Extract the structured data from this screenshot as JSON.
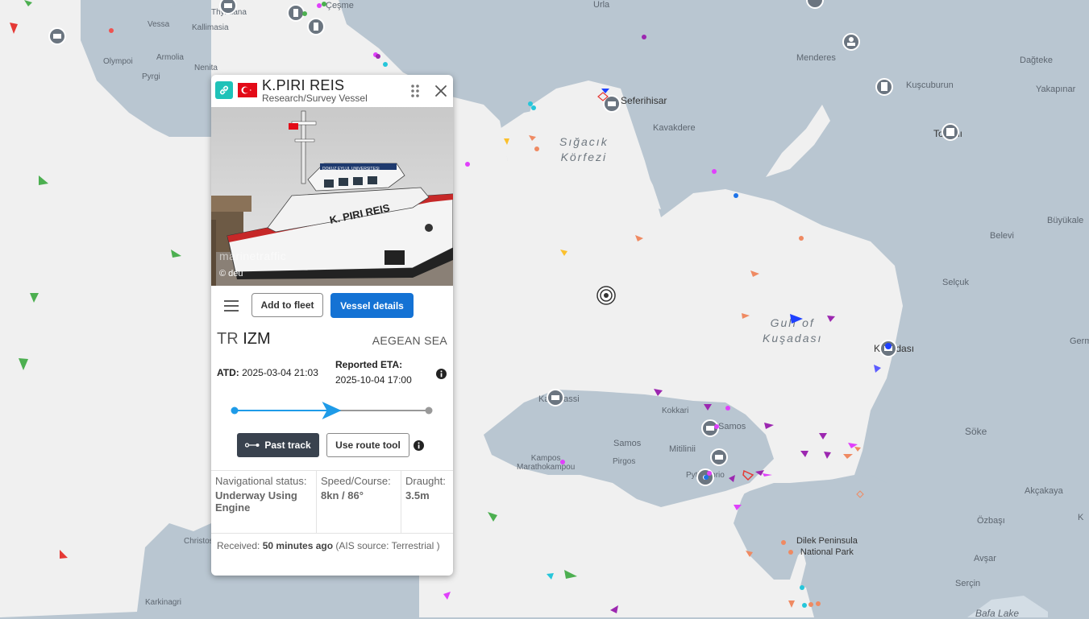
{
  "map": {
    "labels": {
      "urla": "Urla",
      "menderes": "Menderes",
      "dagteke": "Dağteke",
      "kuscuburun": "Kuşcuburun",
      "yakapinar": "Yakapınar",
      "seferihisar": "Seferihisar",
      "kavakdere": "Kavakdere",
      "torbali": "Torbalı",
      "vessa": "Vessa",
      "kallimasia": "Kallimasia",
      "thymiana": "Thymiana",
      "olympoi": "Olympoi",
      "armolia": "Armolia",
      "nenita": "Nenita",
      "pyrgi": "Pyrgi",
      "cesme": "Çeşme",
      "sigacik_line1": "Sığacık",
      "sigacik_line2": "Körfezi",
      "gulf_line1": "Gulf of",
      "gulf_line2": "Kuşadası",
      "kusadasi": "Kuşadası",
      "buyukale": "Büyükale",
      "belevi": "Belevi",
      "selcuk": "Selçuk",
      "germencik": "Germ",
      "karlovassi": "Karlovassi",
      "kokkari": "Kokkari",
      "samos_town": "Samos",
      "samos": "Samos",
      "pirgos": "Pirgos",
      "mitilinii": "Mitilinii",
      "pythagorio": "Pythagorio",
      "kampos_line1": "Kampos",
      "kampos_line2": "Marathokampou",
      "soke": "Söke",
      "akcakaya": "Akçakaya",
      "ozbasi": "Özbaşı",
      "k_edge": "K",
      "avsar": "Avşar",
      "sercin": "Serçin",
      "bafa": "Bafa Lake",
      "christos": "Christos",
      "karkinagri": "Karkinagri",
      "dilek_line1": "Dilek Peninsula",
      "dilek_line2": "National Park"
    }
  },
  "popup": {
    "vessel_name": "K.PIRI REIS",
    "vessel_type": "Research/Survey Vessel",
    "flag_country": "Turkey",
    "photo_watermark": "marinetraffic",
    "photo_credit": "© deu",
    "ship_name_on_hull": "K. PIRI REIS",
    "ship_name_on_bridge": "DOKUZ EYLUL UNIVERSITESI",
    "add_to_fleet_label": "Add to fleet",
    "vessel_details_label": "Vessel details",
    "departure_country": "TR",
    "departure_port": "IZM",
    "area": "AEGEAN SEA",
    "atd_label": "ATD:",
    "atd_value": "2025-03-04 21:03",
    "eta_label": "Reported ETA:",
    "eta_value": "2025-10-04 17:00",
    "voyage_progress_fraction": 0.5,
    "past_track_label": "Past track",
    "route_tool_label": "Use route tool",
    "nav_status_label": "Navigational status:",
    "nav_status_value": "Underway Using Engine",
    "speed_course_label": "Speed/Course:",
    "speed_course_value": "8kn / 86°",
    "draught_label": "Draught:",
    "draught_value": "3.5m",
    "received_label": "Received:",
    "received_value": "50 minutes ago",
    "ais_source_prefix": "(AIS source:",
    "ais_source_value": "Terrestrial )"
  },
  "colors": {
    "land": "#b9c6d1",
    "sea": "#f0f0f0",
    "accent_blue": "#1472d4",
    "link_teal": "#1fc2b8",
    "progress_blue": "#1e9be8",
    "flag_red": "#e30a17"
  }
}
